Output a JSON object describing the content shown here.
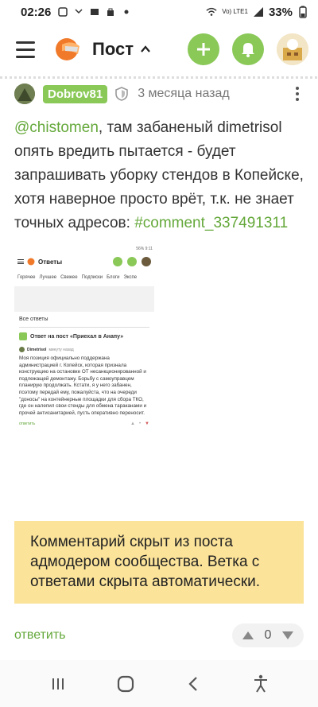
{
  "status_bar": {
    "time": "02:26",
    "network_label": "Vo) LTE1",
    "battery": "33%"
  },
  "header": {
    "title": "Пост",
    "icons": [
      "menu-icon",
      "logo-icon",
      "chevron-up-icon",
      "plus-icon",
      "bell-icon",
      "avatar"
    ]
  },
  "comment": {
    "username": "Dobrov81",
    "time_ago": "3 месяца назад",
    "mention": "@chistomen",
    "text": ", там забаненый dimetrisol опять вредить пытается - будет запрашивать уборку стендов в Копейске, хотя наверное просто врёт, т.к. не знает точных адресов: ",
    "link": "#comment_337491311"
  },
  "embed": {
    "status": "56% 9:11",
    "title": "Ответы",
    "nav": [
      "Горячее",
      "Лучшее",
      "Свежее",
      "Подписки",
      "Блоги",
      "Экспе"
    ],
    "section": "Все ответы",
    "answer_header": "Ответ на пост «Приехал в Анапу»",
    "comment_user": "Dimetrisol",
    "comment_time": "минуту назад",
    "comment_body": "Моя позиция официально поддержана администрацией г. Копейск, которая признала конструкцию на остановке ОТ несанкционированной и подлежащей демонтажу. Борьбу с самоуправцем планирую продолжать. Кстати, я у него забанен, поэтому передай ему, пожалуйста, что на очереди \"доносы\" на контейнерные площадки для сбора ТКО, где он налепил свои стенды для обмена тараканами и прочей антисанитарией, пусть оперативно переносит.",
    "reply_label": "ответить"
  },
  "hidden_notice": "Комментарий скрыт из поста адмодером сообщества. Ветка с ответами скрыта автоматически.",
  "actions": {
    "reply_label": "ответить",
    "vote_count": "0"
  },
  "colors": {
    "accent": "#8ac858",
    "link": "#64a83a",
    "notice_bg": "#fbe39a"
  }
}
